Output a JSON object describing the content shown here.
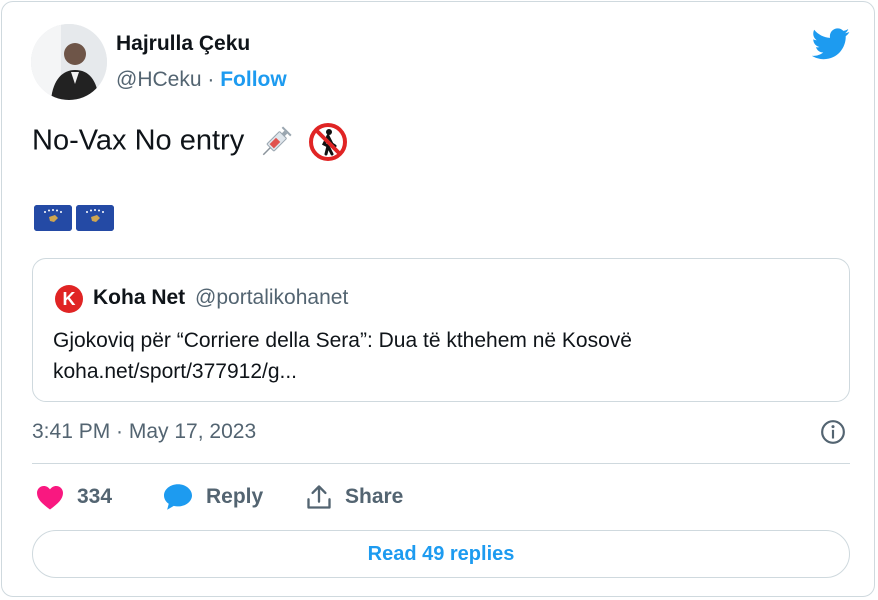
{
  "author": {
    "name": "Hajrulla Çeku",
    "handle": "@HCeku",
    "separator": "·",
    "follow_label": "Follow"
  },
  "tweet": {
    "text": "No-Vax No entry",
    "emojis": [
      "syringe-emoji",
      "no-pedestrians-emoji",
      "kosovo-flag-emoji",
      "kosovo-flag-emoji"
    ]
  },
  "quoted_tweet": {
    "logo_letter": "K",
    "name": "Koha Net",
    "handle": "@portalikohanet",
    "text_line1": "Gjokoviq për “Corriere della Sera”: Dua të kthehem në Kosovë",
    "text_line2": "koha.net/sport/377912/g..."
  },
  "timestamp": "3:41 PM · May 17, 2023",
  "actions": {
    "like_count": "334",
    "reply_label": "Reply",
    "share_label": "Share"
  },
  "read_replies_label": "Read 49 replies",
  "colors": {
    "accent": "#1d9bf0",
    "like": "#f91880",
    "secondary_text": "#536471",
    "border": "#cfd9de",
    "kosovo_flag": "#244aa5",
    "koha_logo": "#e02424"
  }
}
